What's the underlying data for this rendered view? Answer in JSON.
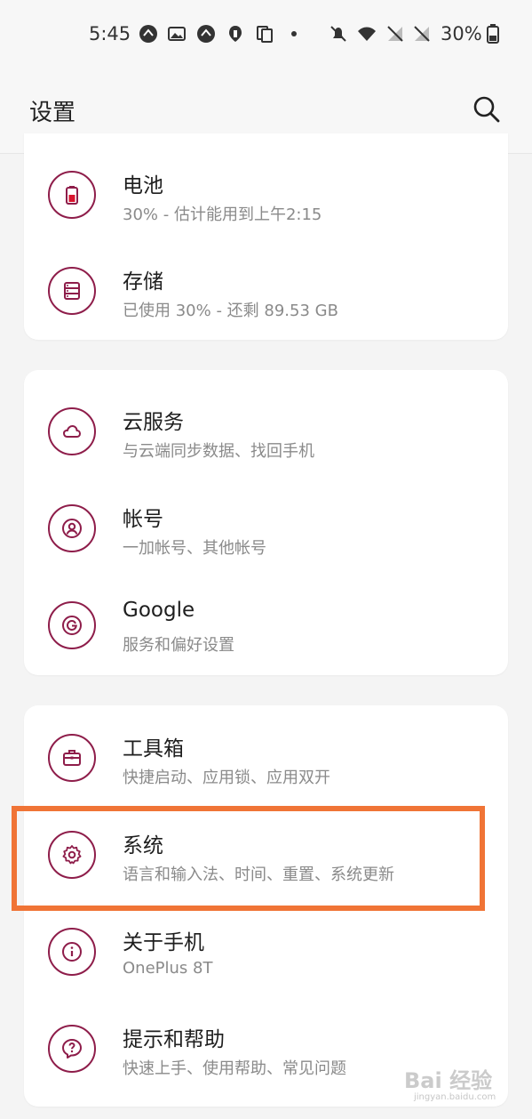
{
  "status_bar": {
    "time": "5:45",
    "battery": "30%",
    "icons": [
      "notification-icon",
      "gallery-icon",
      "notification-icon",
      "oneplus-icon",
      "clipboard-icon",
      "dot-icon",
      "silent-icon",
      "wifi-icon",
      "no-signal-icon",
      "no-signal-icon",
      "battery-icon"
    ]
  },
  "header": {
    "title": "设置"
  },
  "colors": {
    "accent": "#8e1d4a",
    "highlight": "#f07436"
  },
  "groups": [
    {
      "items": [
        {
          "title": "电池",
          "subtitle": "30% - 估计能用到上午2:15",
          "icon": "battery-icon"
        },
        {
          "title": "存储",
          "subtitle": "已使用 30% - 还剩 89.53 GB",
          "icon": "storage-icon"
        }
      ]
    },
    {
      "items": [
        {
          "title": "云服务",
          "subtitle": "与云端同步数据、找回手机",
          "icon": "cloud-icon"
        },
        {
          "title": "帐号",
          "subtitle": "一加帐号、其他帐号",
          "icon": "account-icon"
        },
        {
          "title": "Google",
          "subtitle": "服务和偏好设置",
          "icon": "google-icon"
        }
      ]
    },
    {
      "items": [
        {
          "title": "工具箱",
          "subtitle": "快捷启动、应用锁、应用双开",
          "icon": "toolbox-icon"
        },
        {
          "title": "系统",
          "subtitle": "语言和输入法、时间、重置、系统更新",
          "icon": "gear-icon"
        },
        {
          "title": "关于手机",
          "subtitle": "OnePlus 8T",
          "icon": "info-icon"
        },
        {
          "title": "提示和帮助",
          "subtitle": "快速上手、使用帮助、常见问题",
          "icon": "help-icon"
        }
      ]
    }
  ],
  "watermark": {
    "text": "Bai 经验",
    "sub": "jingyan.baidu.com"
  }
}
